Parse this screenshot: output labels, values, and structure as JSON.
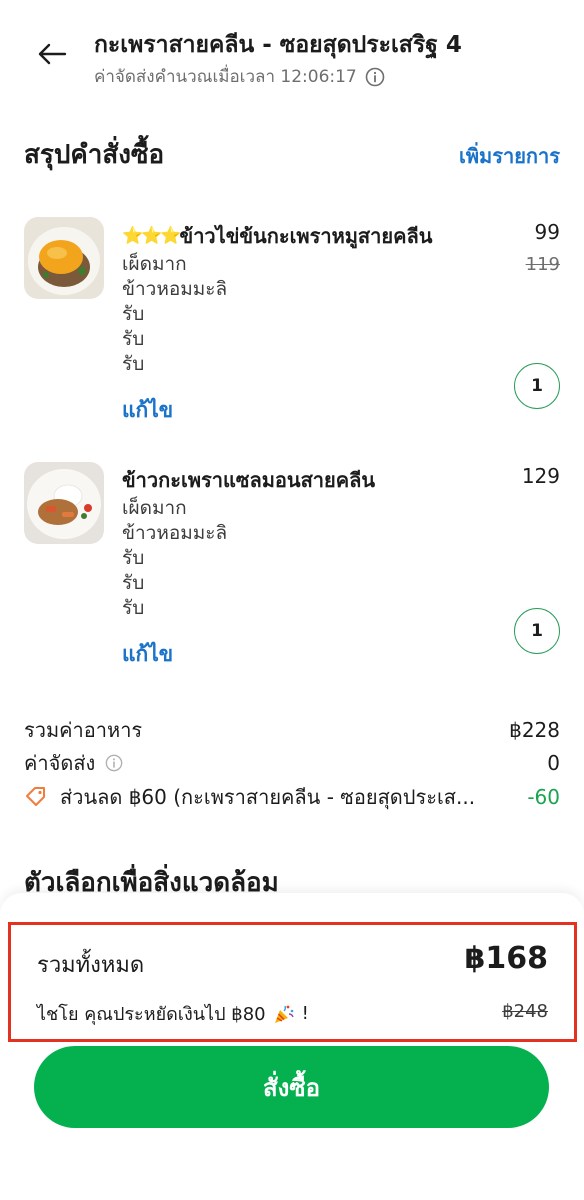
{
  "header": {
    "title": "กะเพราสายคลีน - ซอยสุดประเสริฐ 4",
    "subtitle": "ค่าจัดส่งคำนวณเมื่อเวลา 12:06:17"
  },
  "summary": {
    "title": "สรุปคำสั่งซื้อ",
    "add_items_label": "เพิ่มรายการ"
  },
  "items": [
    {
      "name_prefix": "⭐⭐⭐",
      "name": "ข้าวไข่ข้นกะเพราหมูสายคลีน",
      "price": "99",
      "old_price": "119",
      "options": [
        "เผ็ดมาก",
        "ข้าวหอมมะลิ",
        "รับ",
        "รับ",
        "รับ"
      ],
      "edit_label": "แก้ไข",
      "quantity": "1"
    },
    {
      "name": "ข้าวกะเพราแซลมอนสายคลีน",
      "price": "129",
      "options": [
        "เผ็ดมาก",
        "ข้าวหอมมะลิ",
        "รับ",
        "รับ",
        "รับ"
      ],
      "edit_label": "แก้ไข",
      "quantity": "1"
    }
  ],
  "costs": {
    "food_label": "รวมค่าอาหาร",
    "food_value": "฿228",
    "delivery_label": "ค่าจัดส่ง",
    "delivery_value": "0",
    "discount_label": "ส่วนลด ฿60 (กะเพราสายคลีน - ซอยสุดประเส...",
    "discount_value": "-60"
  },
  "environment": {
    "title": "ตัวเลือกเพื่อสิ่งแวดล้อม"
  },
  "total": {
    "label": "รวมทั้งหมด",
    "amount": "฿168",
    "saving_text": "ไชโย คุณประหยัดเงินไป ฿80",
    "saving_suffix": "!",
    "original": "฿248"
  },
  "order_button": {
    "label": "สั่งซื้อ"
  },
  "colors": {
    "accent_blue": "#1a73c9",
    "primary_green": "#05b04f",
    "discount_green": "#1aa44f",
    "highlight_red": "#e3321f"
  }
}
